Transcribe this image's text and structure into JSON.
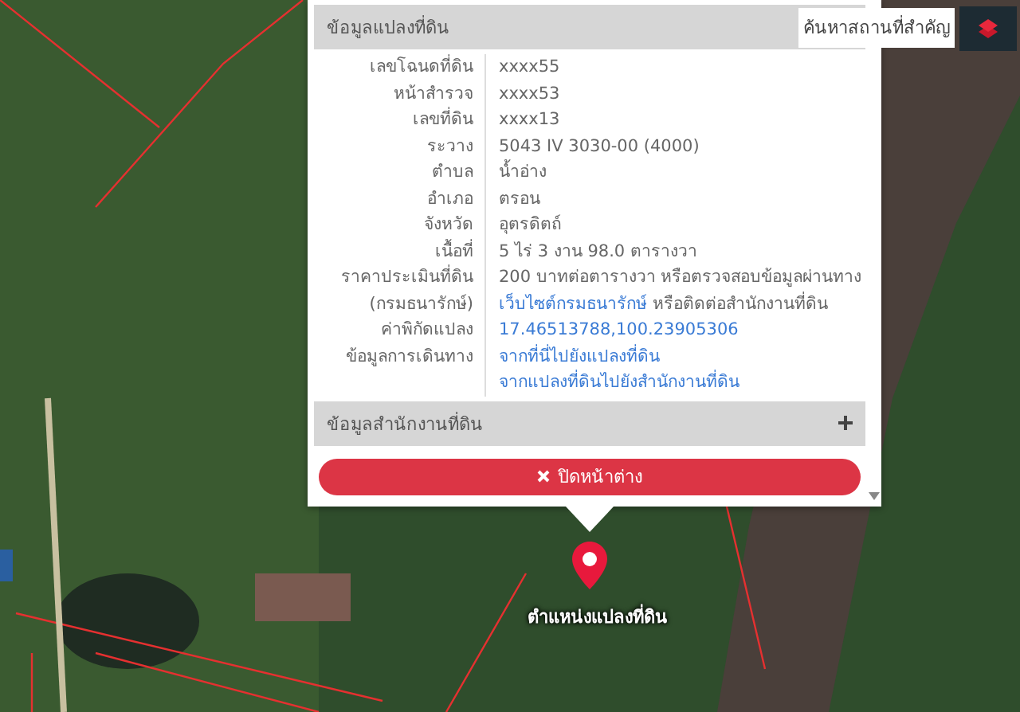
{
  "popup": {
    "title": "ข้อมูลแปลงที่ดิน",
    "rows": [
      {
        "label": "เลขโฉนดที่ดิน",
        "lines": [
          [
            {
              "text": "xxxx55",
              "link": false
            }
          ]
        ]
      },
      {
        "label": "หน้าสำรวจ",
        "lines": [
          [
            {
              "text": "xxxx53",
              "link": false
            }
          ]
        ]
      },
      {
        "label": "เลขที่ดิน",
        "lines": [
          [
            {
              "text": "xxxx13",
              "link": false
            }
          ]
        ]
      },
      {
        "label": "ระวาง",
        "lines": [
          [
            {
              "text": "5043 IV 3030-00 (4000)",
              "link": false
            }
          ]
        ]
      },
      {
        "label": "ตำบล",
        "lines": [
          [
            {
              "text": "น้ำอ่าง",
              "link": false
            }
          ]
        ]
      },
      {
        "label": "อำเภอ",
        "lines": [
          [
            {
              "text": "ตรอน",
              "link": false
            }
          ]
        ]
      },
      {
        "label": "จังหวัด",
        "lines": [
          [
            {
              "text": "อุตรดิตถ์",
              "link": false
            }
          ]
        ]
      },
      {
        "label": "เนื้อที่",
        "lines": [
          [
            {
              "text": "5 ไร่ 3 งาน 98.0 ตารางวา",
              "link": false
            }
          ]
        ]
      },
      {
        "label": "ราคาประเมินที่ดิน",
        "lines": [
          [
            {
              "text": "200 บาทต่อตารางวา หรือตรวจสอบข้อมูลผ่านทาง",
              "link": false
            }
          ]
        ]
      },
      {
        "label": "(กรมธนารักษ์)",
        "lines": [
          [
            {
              "text": "เว็บไซต์กรมธนารักษ์",
              "link": true
            },
            {
              "text": " หรือติดต่อสำนักงานที่ดิน",
              "link": false
            }
          ]
        ]
      },
      {
        "label": "ค่าพิกัดแปลง",
        "lines": [
          [
            {
              "text": "17.46513788,100.23905306",
              "link": true
            }
          ]
        ]
      },
      {
        "label": "ข้อมูลการเดินทาง",
        "lines": [
          [
            {
              "text": "จากที่นี่ไปยังแปลงที่ดิน",
              "link": true
            }
          ],
          [
            {
              "text": "จากแปลงที่ดินไปยังสำนักงานที่ดิน",
              "link": true
            }
          ]
        ]
      }
    ],
    "section": {
      "title": "ข้อมูลสำนักงานที่ดิน",
      "expanded": false
    },
    "close_button": {
      "label": "ปิดหน้าต่าง"
    }
  },
  "marker": {
    "label": "ตำแหน่งแปลงที่ดิน"
  },
  "search": {
    "placeholder": "ค้นหาสถานที่สำคัญ"
  }
}
